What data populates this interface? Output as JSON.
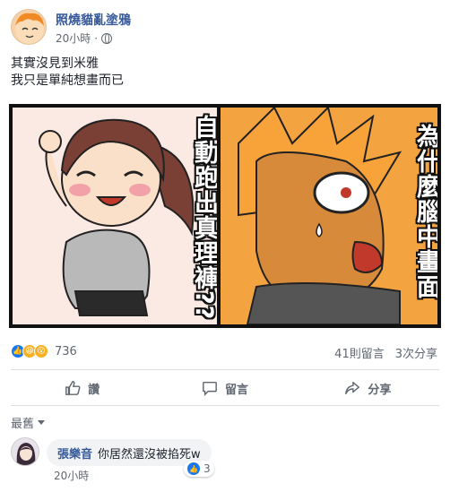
{
  "post": {
    "author": "照燒貓亂塗鴉",
    "time": "20小時",
    "text_line1": "其實沒見到米雅",
    "text_line2": "我只是單純想畫而已"
  },
  "comic": {
    "left_caption": "自動跑出真理褲??",
    "right_caption": "為什麼腦中畫面"
  },
  "reactions": {
    "count": "736",
    "comments": "41則留言",
    "shares": "3次分享"
  },
  "actions": {
    "like": "讚",
    "comment": "留言",
    "share": "分享"
  },
  "comments": {
    "sort_label": "最舊",
    "items": [
      {
        "author": "張樂音",
        "text": "你居然還沒被掐死w",
        "time": "20小時",
        "likes": "3"
      }
    ]
  }
}
